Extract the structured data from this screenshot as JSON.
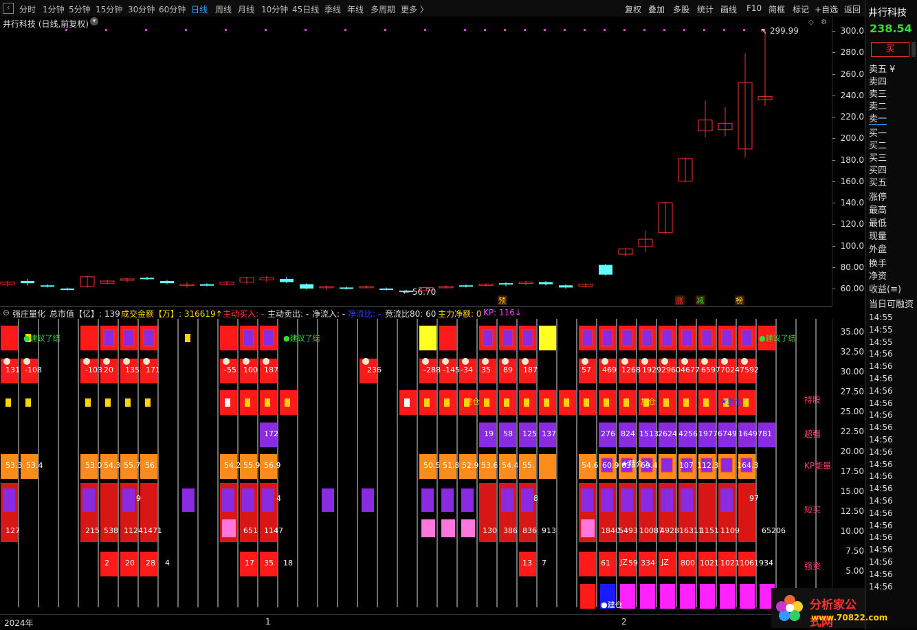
{
  "toolbar": {
    "periods": [
      "分时",
      "1分钟",
      "5分钟",
      "15分钟",
      "30分钟",
      "60分钟",
      "日线",
      "周线",
      "月线",
      "10分钟",
      "45日线",
      "季线",
      "年线",
      "多周期",
      "更多 〉"
    ],
    "active_period": "日线",
    "right_buttons": [
      "复权",
      "叠加",
      "多股",
      "统计",
      "画线",
      "F10",
      "简框",
      "标记",
      "+自选",
      "返回"
    ]
  },
  "chart": {
    "title": "井行科技 (日线,前复权)",
    "high_label": "299.99",
    "low_label": "56.70",
    "markers": [
      "预",
      "涨",
      "减",
      "榜"
    ]
  },
  "chart_data": {
    "type": "candlestick",
    "ylim": [
      50,
      310
    ],
    "yticks": [
      "300.0",
      "280.0",
      "260.0",
      "240.0",
      "220.0",
      "200.0",
      "180.0",
      "160.0",
      "140.0",
      "120.0",
      "100.0",
      "80.00",
      "60.00"
    ],
    "candles": [
      [
        64,
        66,
        62,
        67,
        "down"
      ],
      [
        67,
        65,
        63,
        69,
        "up"
      ],
      [
        62,
        63,
        61,
        64,
        "up"
      ],
      [
        59,
        60,
        58,
        61,
        "up"
      ],
      [
        62,
        71,
        61,
        72,
        "down"
      ],
      [
        65,
        67,
        64,
        68,
        "down"
      ],
      [
        68,
        69,
        66,
        70,
        "down"
      ],
      [
        69,
        70,
        68,
        71,
        "up"
      ],
      [
        67,
        65,
        64,
        68,
        "up"
      ],
      [
        63,
        64,
        61,
        66,
        "down"
      ],
      [
        63,
        64,
        62,
        65,
        "up"
      ],
      [
        64,
        66,
        63,
        67,
        "down"
      ],
      [
        66,
        70,
        64,
        71,
        "down"
      ],
      [
        68,
        70,
        66,
        72,
        "down"
      ],
      [
        69,
        66,
        65,
        71,
        "up"
      ],
      [
        64,
        60,
        59,
        65,
        "up"
      ],
      [
        61,
        62,
        59,
        63,
        "down"
      ],
      [
        60,
        61,
        59,
        62,
        "up"
      ],
      [
        61,
        62,
        60,
        63,
        "down"
      ],
      [
        59,
        60,
        58,
        61,
        "up"
      ],
      [
        57,
        58,
        56.7,
        59,
        "up"
      ],
      [
        58,
        61,
        57,
        62,
        "down"
      ],
      [
        61,
        62,
        60,
        63,
        "down"
      ],
      [
        62,
        63,
        61,
        64,
        "up"
      ],
      [
        63,
        64,
        62,
        65,
        "down"
      ],
      [
        64,
        65,
        62,
        66,
        "up"
      ],
      [
        65,
        66,
        63,
        67,
        "down"
      ],
      [
        66,
        64,
        63,
        67,
        "up"
      ],
      [
        63,
        61,
        60,
        64,
        "up"
      ],
      [
        62,
        64,
        61,
        65,
        "down"
      ],
      [
        73,
        82,
        72,
        83,
        "up"
      ],
      [
        92,
        97,
        90,
        98,
        "down"
      ],
      [
        99,
        106,
        94,
        114,
        "down"
      ],
      [
        112,
        140,
        111,
        141,
        "down"
      ],
      [
        160,
        181,
        159,
        182,
        "down"
      ],
      [
        207,
        217,
        201,
        235,
        "down"
      ],
      [
        208,
        214,
        202,
        229,
        "down"
      ],
      [
        190,
        252,
        182,
        279,
        "down"
      ],
      [
        236,
        239,
        230,
        299.99,
        "down"
      ]
    ]
  },
  "indicator": {
    "name": "强庄量化",
    "mkt_cap_label": "总市值【亿】: 139",
    "amount_label": "成交金额【万】: 316619↑",
    "buy_label": "主动买入: -",
    "sell_label": "主动卖出: -",
    "netin_label": "净流入: -",
    "netratio_label": "净流比: -",
    "jingliu_label": "竞流比80: 60",
    "main_net_label": "主力净额: 0",
    "kp_label": "KP: 116↓",
    "yticks": [
      "35.00",
      "32.50",
      "30.00",
      "27.50",
      "25.00",
      "22.50",
      "20.00",
      "17.50",
      "15.00",
      "12.50",
      "10.00",
      "7.50",
      "5.00"
    ],
    "row_labels": [
      "持股",
      "超强",
      "KP能量",
      "短买",
      "强资"
    ],
    "texts": {
      "jianyi1": "●建议了结",
      "jianyi2": "●建议了结",
      "jianyi3": "●建议了结",
      "jiancang": "建仓",
      "jiacang": "加仓",
      "zhongcang": "★重仓",
      "jingjie": "★精介入",
      "jz1": "JZ",
      "jz2": "JZ",
      "bottom_jiancang": "●建仓"
    },
    "row2_nums": [
      "131",
      "-108",
      "-103",
      "20",
      "135",
      "171",
      "-55",
      "100",
      "187",
      "236",
      "-288",
      "-145",
      "-34",
      "35",
      "89",
      "187",
      "57",
      "469",
      "1268",
      "1929",
      "2960",
      "4677",
      "6597",
      "7024",
      "7592"
    ],
    "row4_nums": [
      "172",
      "19",
      "58",
      "125",
      "137",
      "276",
      "824",
      "1513",
      "2624",
      "4256",
      "1977",
      "6749",
      "1649781"
    ],
    "row5_nums": [
      "53.3",
      "53.4",
      "53.0",
      "54.3",
      "55.7",
      "56.",
      "54.2",
      "55.9",
      "56.9",
      "50.5",
      "51.8",
      "52.9",
      "53.6",
      "54.4",
      "55.",
      "54.6",
      "60.9",
      "63.",
      "69.4",
      "107",
      "112.3",
      "164.3"
    ],
    "row6_nums": [
      "9",
      "4",
      "8",
      "97"
    ],
    "row7_nums": [
      "127",
      "215",
      "538",
      "1124",
      "1471",
      "651",
      "1147",
      "130",
      "386",
      "836",
      "913",
      "1840",
      "5493",
      "10087",
      "4928",
      "16311",
      "1151",
      "1109",
      "65206"
    ],
    "row8_nums": [
      "2",
      "20",
      "28",
      "4",
      "17",
      "35",
      "18",
      "13",
      "7",
      "61",
      "59",
      "334",
      "800",
      "1021",
      "1021",
      "1061934"
    ]
  },
  "sidebar": {
    "name": "井行科技",
    "price": "238.54",
    "buy_btn": "买",
    "rows": [
      "卖五 ¥",
      "卖四",
      "卖三",
      "卖二",
      "卖一",
      "买一",
      "买二",
      "买三",
      "买四",
      "买五",
      "涨停",
      "最高",
      "最低",
      "现量",
      "外盘",
      "换手",
      "净资",
      "收益(≡)",
      "当日可融资"
    ],
    "times": [
      "14:55",
      "14:55",
      "14:55",
      "14:56",
      "14:56",
      "14:56",
      "14:56",
      "14:56",
      "14:56",
      "14:56",
      "14:56",
      "14:56",
      "14:56",
      "14:56",
      "14:56",
      "14:56",
      "14:56",
      "14:56",
      "14:56",
      "14:56",
      "14:56",
      "14:56",
      "14:56"
    ]
  },
  "bottom": {
    "year": "2024年",
    "m1": "1",
    "m2": "2",
    "watermark": "分析家公式网",
    "watermark_url": "www.70822.com"
  }
}
